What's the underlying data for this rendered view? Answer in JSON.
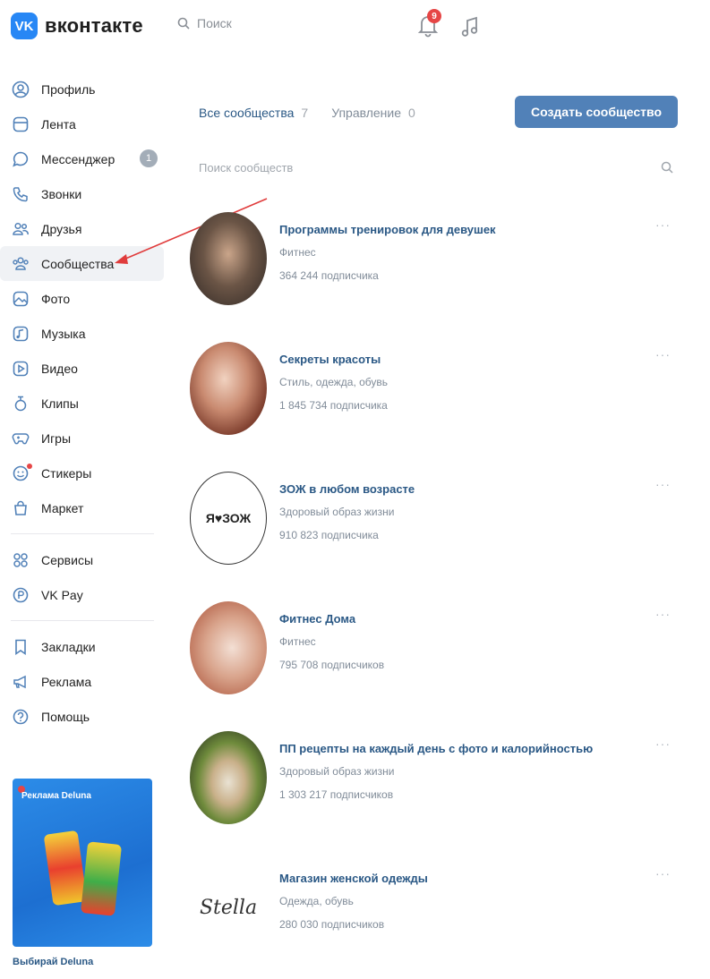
{
  "header": {
    "logo_mark": "VK",
    "logo_text": "вконтакте",
    "search_placeholder": "Поиск",
    "notifications_count": "9"
  },
  "sidebar": {
    "items": [
      {
        "label": "Профиль",
        "icon": "profile-icon"
      },
      {
        "label": "Лента",
        "icon": "feed-icon"
      },
      {
        "label": "Мессенджер",
        "icon": "messenger-icon",
        "badge": "1"
      },
      {
        "label": "Звонки",
        "icon": "phone-icon"
      },
      {
        "label": "Друзья",
        "icon": "friends-icon"
      },
      {
        "label": "Сообщества",
        "icon": "communities-icon",
        "active": true
      },
      {
        "label": "Фото",
        "icon": "photo-icon"
      },
      {
        "label": "Музыка",
        "icon": "music-icon"
      },
      {
        "label": "Видео",
        "icon": "video-icon"
      },
      {
        "label": "Клипы",
        "icon": "clips-icon"
      },
      {
        "label": "Игры",
        "icon": "games-icon"
      },
      {
        "label": "Стикеры",
        "icon": "stickers-icon"
      },
      {
        "label": "Маркет",
        "icon": "market-icon"
      }
    ],
    "items2": [
      {
        "label": "Сервисы",
        "icon": "services-icon"
      },
      {
        "label": "VK Pay",
        "icon": "vkpay-icon"
      }
    ],
    "items3": [
      {
        "label": "Закладки",
        "icon": "bookmark-icon"
      },
      {
        "label": "Реклама",
        "icon": "ads-icon"
      },
      {
        "label": "Помощь",
        "icon": "help-icon"
      }
    ],
    "ad_tag": "Реклама Deluna",
    "ad_caption": "Выбирай Deluna"
  },
  "main": {
    "tabs": [
      {
        "label": "Все сообщества",
        "count": "7"
      },
      {
        "label": "Управление",
        "count": "0"
      }
    ],
    "create_button": "Создать сообщество",
    "search_placeholder": "Поиск сообществ",
    "communities": [
      {
        "name": "Программы тренировок для девушек",
        "category": "Фитнес",
        "subscribers": "364 244 подписчика"
      },
      {
        "name": "Секреты красоты",
        "category": "Стиль, одежда, обувь",
        "subscribers": "1 845 734 подписчика"
      },
      {
        "name": "ЗОЖ в любом возрасте",
        "category": "Здоровый образ жизни",
        "subscribers": "910 823 подписчика",
        "avatar_text": "Я♥ЗОЖ"
      },
      {
        "name": "Фитнес Дома",
        "category": "Фитнес",
        "subscribers": "795 708 подписчиков"
      },
      {
        "name": "ПП рецепты на каждый день с фото и калорийностью",
        "category": "Здоровый образ жизни",
        "subscribers": "1 303 217 подписчиков"
      },
      {
        "name": "Магазин женской одежды",
        "category": "Одежда, обувь",
        "subscribers": "280 030 подписчиков",
        "avatar_text": "Stella"
      }
    ],
    "more_label": "···"
  },
  "colors": {
    "accent": "#5181b8",
    "link": "#2a5885",
    "badge_red": "#e64646",
    "annotation_arrow": "#e03c3c"
  }
}
